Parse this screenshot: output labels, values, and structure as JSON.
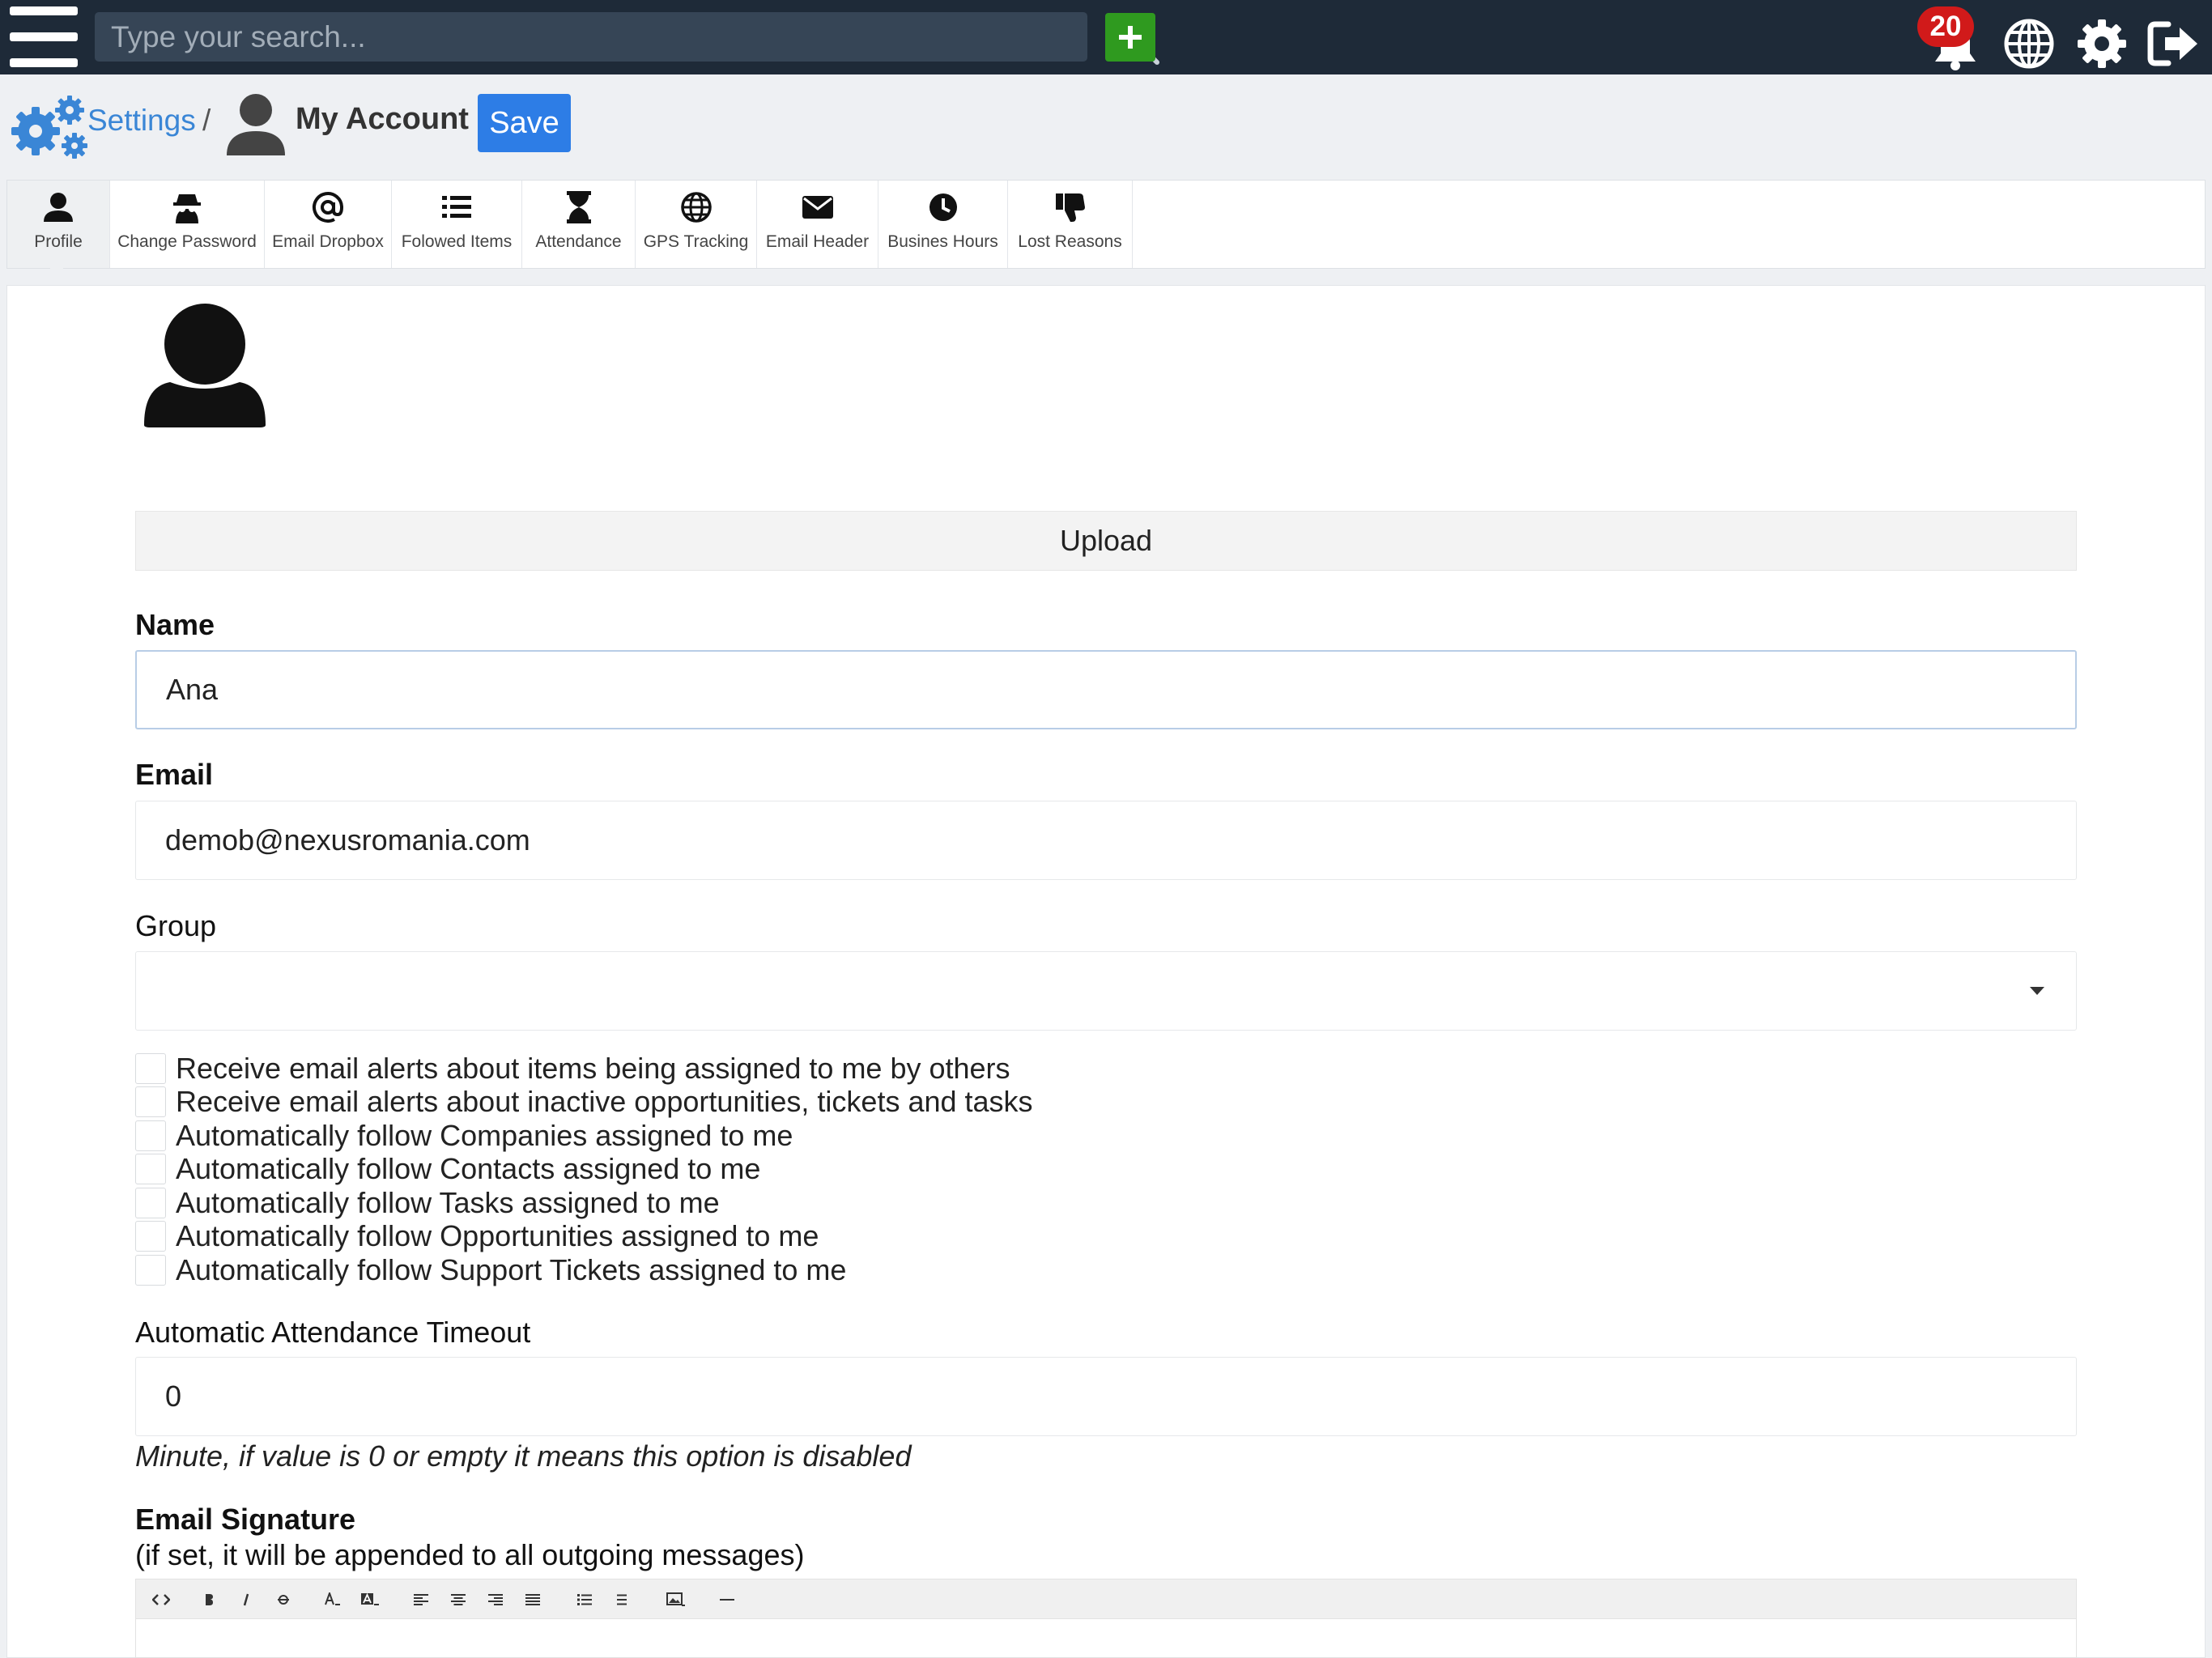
{
  "topbar": {
    "search_placeholder": "Type your search...",
    "notification_count": "20",
    "icons": [
      "hamburger-menu-icon",
      "search-icon",
      "plus-icon",
      "bell-icon",
      "globe-icon",
      "gear-icon",
      "logout-icon"
    ]
  },
  "breadcrumb": {
    "settings_label": "Settings",
    "separator": "/",
    "page_title": "My Account",
    "save_label": "Save"
  },
  "tabs": [
    {
      "label": "Profile",
      "icon": "user-icon",
      "active": true
    },
    {
      "label": "Change Password",
      "icon": "spy-icon"
    },
    {
      "label": "Email Dropbox",
      "icon": "at-icon"
    },
    {
      "label": "Folowed Items",
      "icon": "list-icon"
    },
    {
      "label": "Attendance",
      "icon": "hourglass-icon"
    },
    {
      "label": "GPS Tracking",
      "icon": "globe-icon"
    },
    {
      "label": "Email Header",
      "icon": "envelope-icon"
    },
    {
      "label": "Busines Hours",
      "icon": "clock-icon"
    },
    {
      "label": "Lost Reasons",
      "icon": "thumbs-down-icon"
    }
  ],
  "profile": {
    "upload_label": "Upload",
    "name_label": "Name",
    "name_value": "Ana",
    "email_label": "Email",
    "email_value": "demob@nexusromania.com",
    "group_label": "Group",
    "group_value": "",
    "checkboxes": [
      "Receive email alerts about items being assigned to me by others",
      "Receive email alerts about inactive opportunities, tickets and tasks",
      "Automatically follow Companies assigned to me",
      "Automatically follow Contacts assigned to me",
      "Automatically follow Tasks assigned to me",
      "Automatically follow Opportunities assigned to me",
      "Automatically follow Support Tickets assigned to me"
    ],
    "timeout_label": "Automatic Attendance Timeout",
    "timeout_value": "0",
    "timeout_hint": "Minute, if value is 0 or empty it means this option is disabled",
    "signature_label": "Email Signature",
    "signature_note": "(if set, it will be appended to all outgoing messages)"
  },
  "editor_toolbar": {
    "buttons": [
      "code-view",
      "bold",
      "italic",
      "strikethrough",
      "font-color",
      "background-color",
      "align-left",
      "align-center",
      "align-right",
      "justify",
      "ordered-list",
      "unordered-list",
      "insert-image",
      "horizontal-rule"
    ]
  },
  "colors": {
    "topbar": "#1e2a38",
    "accent": "#2d7de6",
    "add": "#2f9a1f",
    "badge": "#d11a1a",
    "link": "#3a86d6"
  }
}
